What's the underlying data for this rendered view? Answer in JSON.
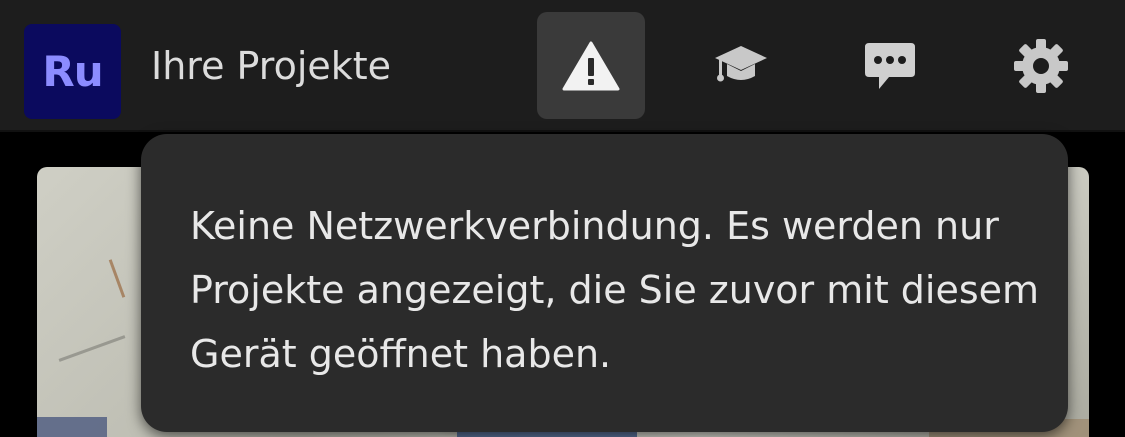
{
  "app": {
    "logo_text": "Ru",
    "logo_bg_color": "#0b0a5e",
    "logo_text_color": "#8c8cff"
  },
  "header": {
    "title": "Ihre Projekte",
    "icons": [
      "warning-icon",
      "learn-icon",
      "feedback-icon",
      "settings-icon"
    ],
    "active_icon": "warning-icon"
  },
  "tooltip": {
    "message": "Keine Netzwerkverbindung. Es werden nur Projekte angezeigt, die Sie zuvor mit diesem Gerät geöffnet haben."
  },
  "colors": {
    "topbar": "#1d1d1d",
    "tooltip": "#2b2b2b",
    "icon": "#d8d8d8"
  }
}
